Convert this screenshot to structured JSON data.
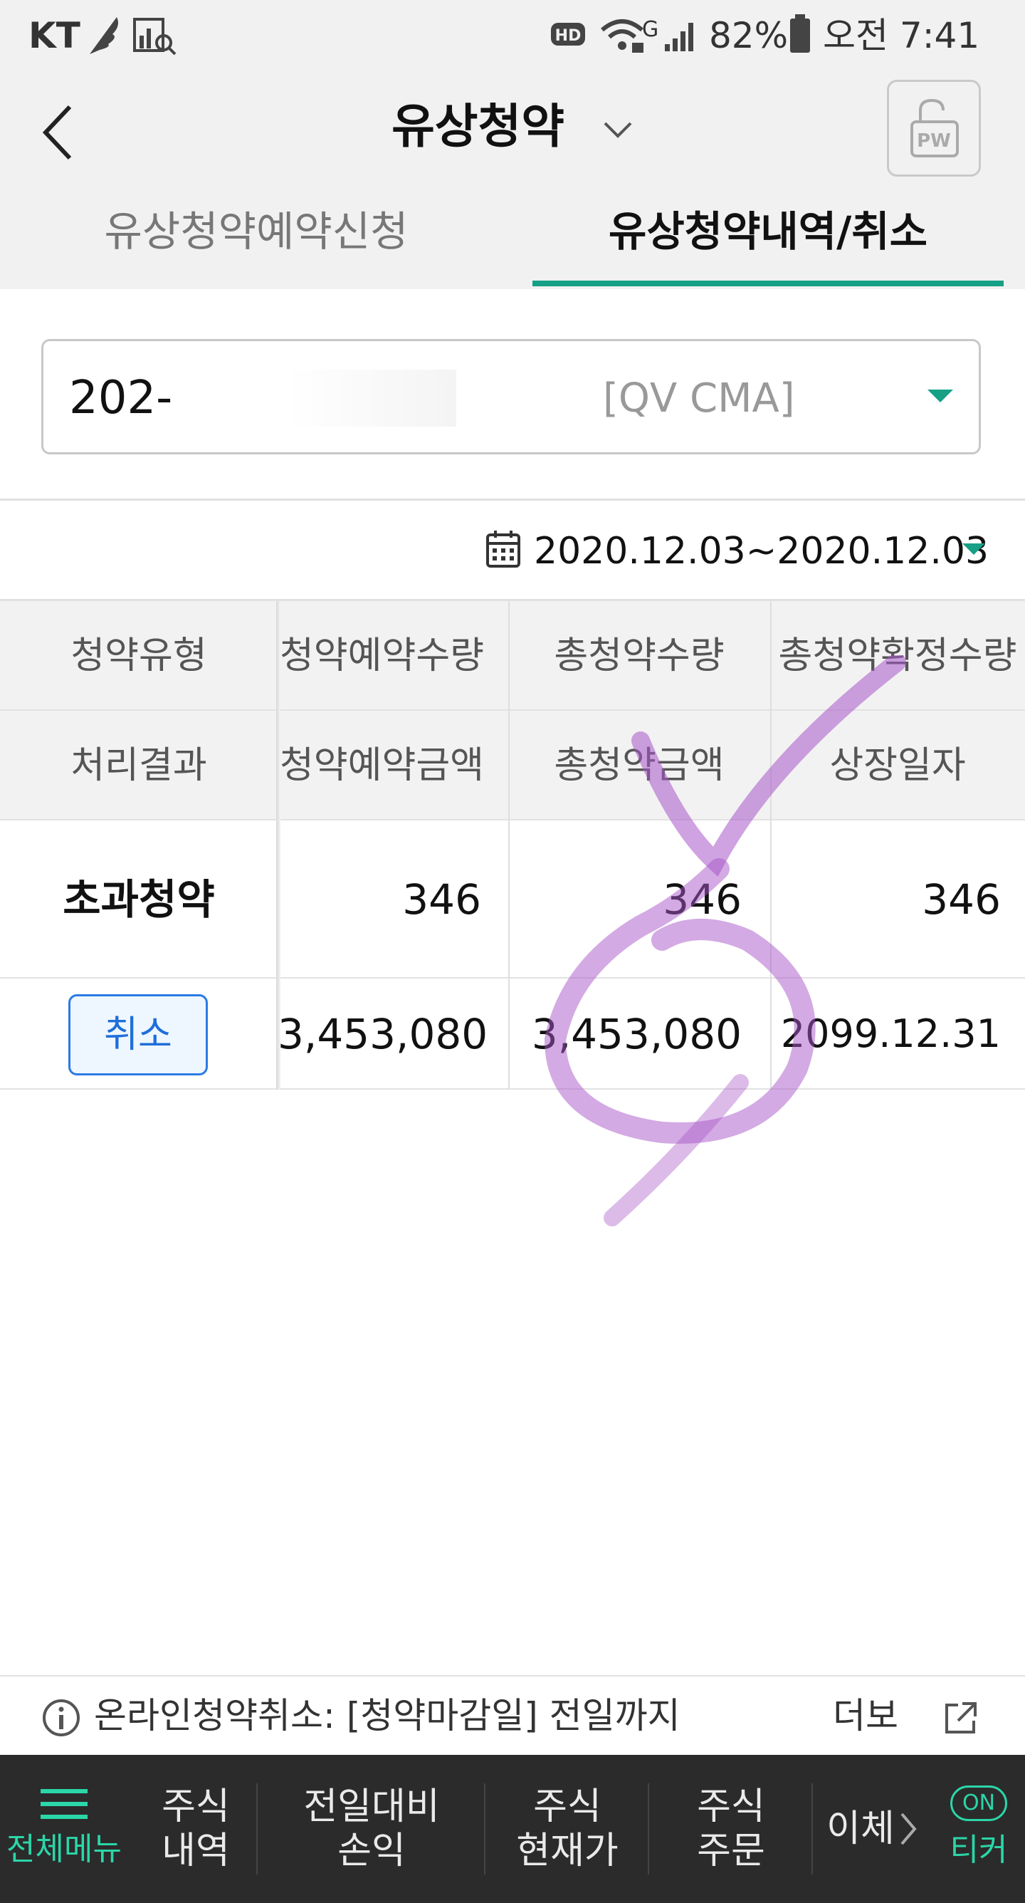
{
  "status_bar": {
    "carrier": "KT",
    "battery": "82%",
    "time": "오전 7:41",
    "network": "G"
  },
  "header": {
    "title": "유상청약",
    "tabs": [
      "유상청약예약신청",
      "유상청약내역/취소"
    ],
    "active_tab": 1,
    "pw_label": "PW"
  },
  "account": {
    "number": "202-",
    "type": "[QV CMA]"
  },
  "date_range": "2020.12.03~2020.12.03",
  "table": {
    "header_row1": [
      "청약유형",
      "청약예약수량",
      "총청약수량",
      "총청약확정수량"
    ],
    "header_row2": [
      "처리결과",
      "청약예약금액",
      "총청약금액",
      "상장일자"
    ],
    "row1": [
      "초과청약",
      "346",
      "346",
      "346"
    ],
    "row2": [
      "취소",
      "3,453,080",
      "3,453,080",
      "2099.12.31"
    ]
  },
  "notice": {
    "text": "온라인청약취소: [청약마감일] 전일까지",
    "more": "더보"
  },
  "bottom_nav": {
    "menu_label": "전체메뉴",
    "items": [
      {
        "line1": "주식",
        "line2": "내역"
      },
      {
        "line1": "전일대비",
        "line2": "손익"
      },
      {
        "line1": "주식",
        "line2": "현재가"
      },
      {
        "line1": "주식",
        "line2": "주문"
      },
      {
        "line1": "이체",
        "line2": ""
      }
    ],
    "ticker_badge": "ON",
    "ticker_label": "티커"
  },
  "colors": {
    "accent": "#16a085",
    "button_blue": "#1e6fd9",
    "annotation_purple": "#a855c8"
  }
}
